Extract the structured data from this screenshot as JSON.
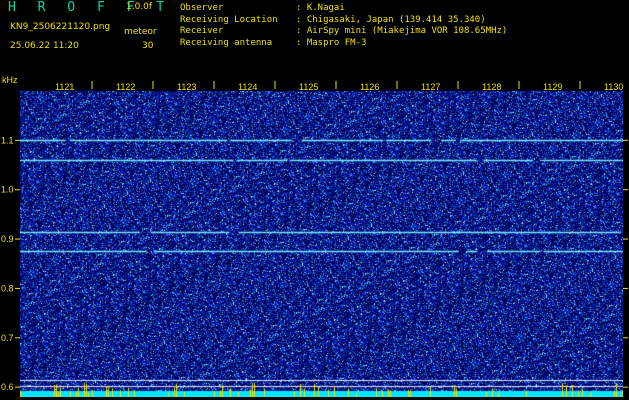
{
  "header": {
    "app_title": "H R O F F T",
    "version": "1.0.0f",
    "filename": "KN9_2506221120.png",
    "mode_label": "meteor",
    "mode_value": "30",
    "datetime": "25.06.22 11:20"
  },
  "info": [
    {
      "label": "Observer",
      "value": ": K.Nagai"
    },
    {
      "label": "Receiving Location",
      "value": ": Chigasaki, Japan (139.414 35.340)"
    },
    {
      "label": "Receiver",
      "value": ": AirSpy mini (Miakejima VOR 108.65MHz)"
    },
    {
      "label": "Receiving antenna",
      "value": ": Maspro FM-3"
    }
  ],
  "spectrogram": {
    "y_unit": "kHz",
    "time_labels": [
      "1121",
      "1122",
      "1123",
      "1124",
      "1125",
      "1126",
      "1127",
      "1128",
      "1129",
      "1130"
    ],
    "freq_labels": [
      "1.1",
      "1.0",
      "0.9",
      "0.8",
      "0.7",
      "0.6"
    ],
    "freq_values": [
      1.1,
      1.0,
      0.9,
      0.8,
      0.7,
      0.6
    ],
    "freq_range": [
      0.58,
      1.2
    ],
    "carrier_lines_khz": [
      1.1,
      1.06,
      0.915,
      0.875
    ],
    "colors": {
      "background": "#00005a",
      "noise": "#3a6cff",
      "carrier": "#78e8ff",
      "axis": "#f0e000",
      "baseline": "#00e8ff"
    }
  }
}
